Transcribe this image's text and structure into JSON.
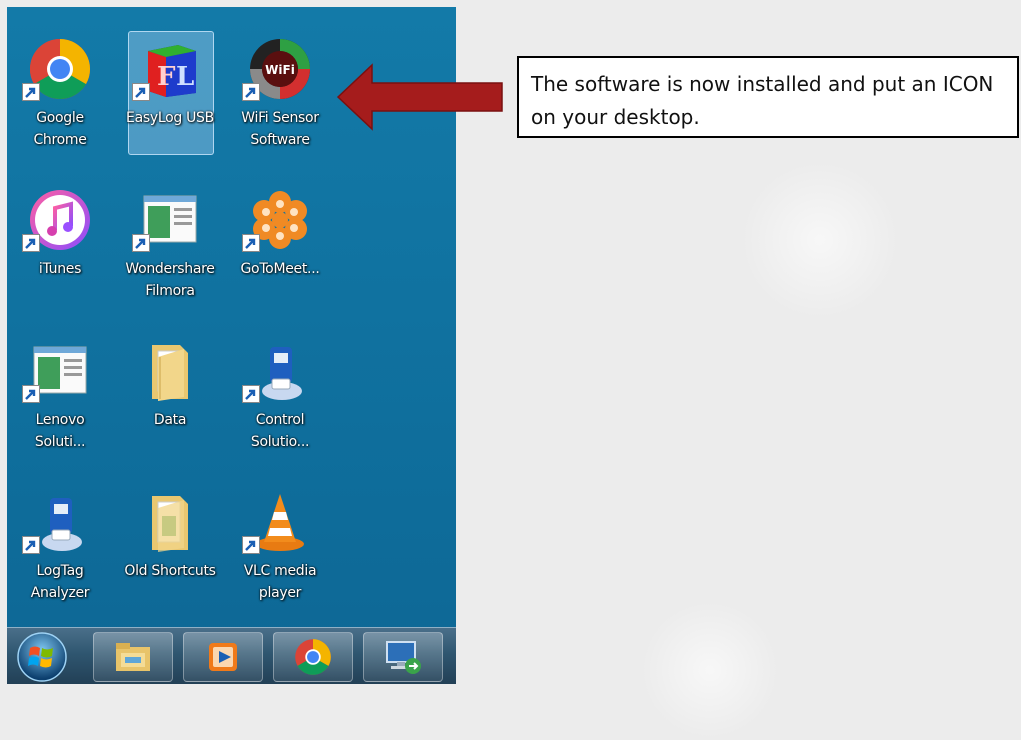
{
  "desktop": {
    "icons": [
      {
        "lines": [
          "Google",
          "Chrome"
        ]
      },
      {
        "lines": [
          "EasyLog USB"
        ]
      },
      {
        "lines": [
          "WiFi Sensor",
          "Software"
        ],
        "badge": "WiFi"
      },
      {
        "lines": [
          "iTunes"
        ]
      },
      {
        "lines": [
          "Wondershare",
          "Filmora"
        ]
      },
      {
        "lines": [
          "GoToMeet..."
        ]
      },
      {
        "lines": [
          "Lenovo",
          "Soluti..."
        ]
      },
      {
        "lines": [
          "Data"
        ]
      },
      {
        "lines": [
          "Control",
          "Solutio..."
        ]
      },
      {
        "lines": [
          "LogTag",
          "Analyzer"
        ]
      },
      {
        "lines": [
          "Old Shortcuts"
        ]
      },
      {
        "lines": [
          "VLC media",
          "player"
        ]
      }
    ]
  },
  "callout": {
    "text": "The software is now installed and put an ICON on your desktop."
  },
  "arrow": {
    "color": "#a51c1c"
  },
  "taskbar": {
    "items": [
      "start-orb",
      "file-explorer-icon",
      "media-player-icon",
      "chrome-icon",
      "remote-desktop-icon"
    ]
  }
}
